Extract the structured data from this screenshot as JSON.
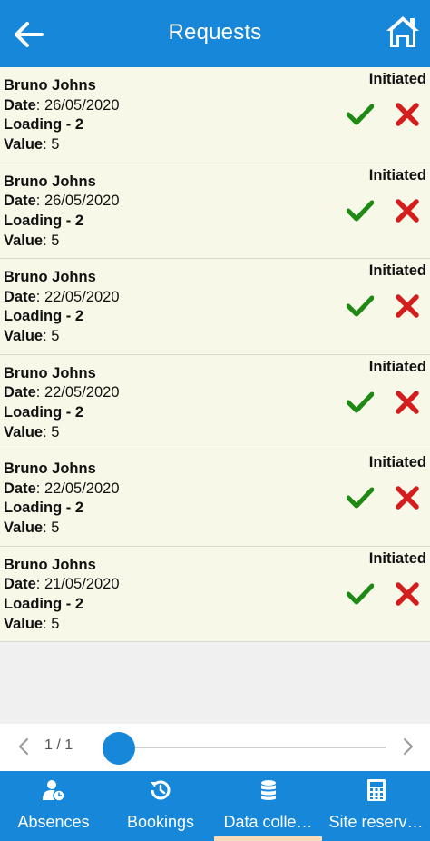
{
  "header": {
    "title": "Requests",
    "back_icon": "arrow-left-icon",
    "home_icon": "home-icon"
  },
  "labels": {
    "date": "Date",
    "loading": "Loading - 2",
    "value": "Value"
  },
  "requests": [
    {
      "name": "Bruno Johns",
      "date": "26/05/2020",
      "value": "5",
      "status": "Initiated"
    },
    {
      "name": "Bruno Johns",
      "date": "26/05/2020",
      "value": "5",
      "status": "Initiated"
    },
    {
      "name": "Bruno Johns",
      "date": "22/05/2020",
      "value": "5",
      "status": "Initiated"
    },
    {
      "name": "Bruno Johns",
      "date": "22/05/2020",
      "value": "5",
      "status": "Initiated"
    },
    {
      "name": "Bruno Johns",
      "date": "22/05/2020",
      "value": "5",
      "status": "Initiated"
    },
    {
      "name": "Bruno Johns",
      "date": "21/05/2020",
      "value": "5",
      "status": "Initiated"
    }
  ],
  "pager": {
    "text": "1 / 1"
  },
  "tabs": [
    {
      "label": "Absences",
      "icon": "user-clock-icon"
    },
    {
      "label": "Bookings",
      "icon": "history-icon"
    },
    {
      "label": "Data colle…",
      "icon": "database-icon",
      "selected": true
    },
    {
      "label": "Site reserv…",
      "icon": "calculator-icon"
    }
  ],
  "colors": {
    "primary": "#1687d9",
    "row_bg": "#f8f8e8",
    "accept": "#1e8a14",
    "reject": "#d41e1e",
    "tab_indicator": "#f9dcb7"
  }
}
